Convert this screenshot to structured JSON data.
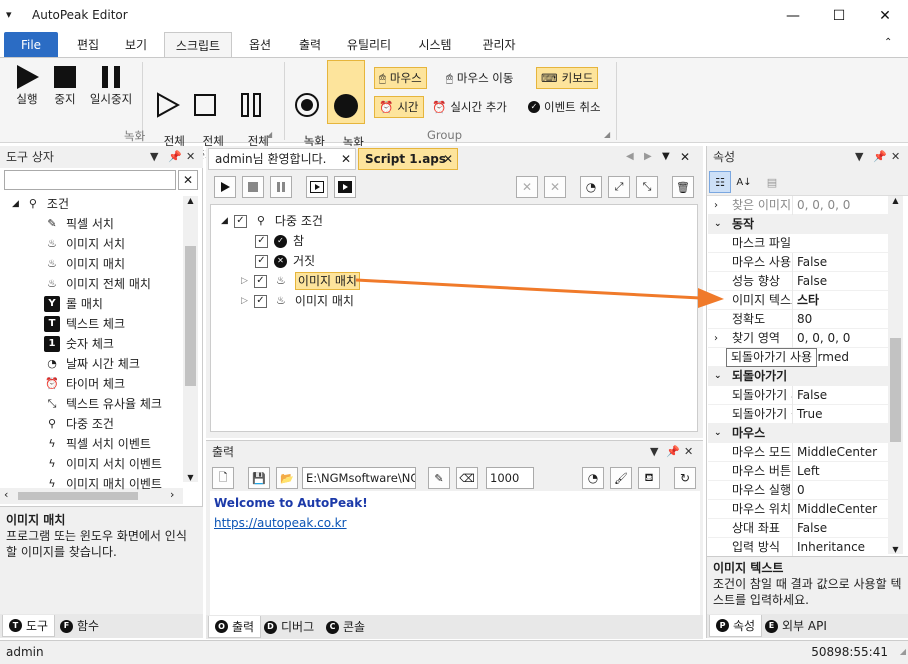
{
  "window": {
    "title": "AutoPeak Editor"
  },
  "menu": {
    "file": "File",
    "tabs": [
      "편집",
      "보기",
      "스크립트",
      "옵션",
      "출력",
      "유틸리티",
      "시스템",
      "관리자"
    ]
  },
  "ribbon": {
    "record_group": {
      "run": "실행",
      "stop": "중지",
      "pause": "일시중지",
      "run_all": "전체\n실행",
      "stop_all": "전체\n중지",
      "pause_all": "전체\n일시중지",
      "label": "녹화"
    },
    "group": {
      "record_start": "녹화\n시작",
      "record_stop": "녹화\n중지",
      "mouse": "마우스",
      "mouse_move": "마우스 이동",
      "keyboard": "키보드",
      "time": "시간",
      "add_realtime": "실시간 추가",
      "cancel_event": "이벤트 취소",
      "label": "Group"
    }
  },
  "toolbox": {
    "title": "도구 상자",
    "root": "조건",
    "items": [
      "픽셀 서치",
      "이미지 서치",
      "이미지 매치",
      "이미지 전체 매치",
      "롤 매치",
      "텍스트 체크",
      "숫자 체크",
      "날짜 시간 체크",
      "타이머 체크",
      "텍스트 유사율 체크",
      "다중 조건",
      "픽셀 서치 이벤트",
      "이미지 서치 이벤트",
      "이미지 매치 이벤트"
    ],
    "desc_title": "이미지 매치",
    "desc_text": "프로그램 또는 윈도우 화면에서 인식할 이미지를 찾습니다.",
    "tabs": [
      "도구",
      "함수"
    ],
    "tab_letters": [
      "T",
      "F"
    ]
  },
  "editor": {
    "tabs": [
      "admin님 환영합니다.",
      "Script 1.aps"
    ],
    "tree": {
      "root": "다중 조건",
      "children": [
        "참",
        "거짓",
        "이미지 매치",
        "이미지 매치"
      ]
    }
  },
  "output": {
    "title": "출력",
    "path": "E:\\NGMsoftware\\NG",
    "count": "1000",
    "welcome": "Welcome to AutoPeak!",
    "link": "https://autopeak.co.kr",
    "tabs": [
      "출력",
      "디버그",
      "콘솔"
    ],
    "tab_letters": [
      "O",
      "D",
      "C"
    ]
  },
  "properties": {
    "title": "속성",
    "top_row": {
      "name": "찾은 이미지",
      "value": "0, 0, 0, 0"
    },
    "cat_action": "동작",
    "action_rows": [
      {
        "name": "마스크 파일",
        "value": ""
      },
      {
        "name": "마우스 사용",
        "value": "False"
      },
      {
        "name": "성능 향상",
        "value": "False"
      },
      {
        "name": "이미지 텍스트",
        "value": "스타"
      },
      {
        "name": "정확도",
        "value": "80"
      },
      {
        "name": "찾기 영역",
        "value": "0, 0, 0, 0"
      },
      {
        "name": "",
        "value": "fNormed"
      }
    ],
    "tooltip": "되돌아가기 사용",
    "cat_return": "되돌아가기",
    "return_rows": [
      {
        "name": "되돌아가기 사용",
        "value": "False"
      },
      {
        "name": "되돌아가기 값",
        "value": "True"
      }
    ],
    "cat_mouse": "마우스",
    "mouse_rows": [
      {
        "name": "마우스 모드",
        "value": "MiddleCenter"
      },
      {
        "name": "마우스 버튼",
        "value": "Left"
      },
      {
        "name": "마우스 실행",
        "value": "0"
      },
      {
        "name": "마우스 위치",
        "value": "MiddleCenter"
      },
      {
        "name": "상대 좌표",
        "value": "False"
      },
      {
        "name": "입력 방식",
        "value": "Inheritance"
      }
    ],
    "desc_title": "이미지 텍스트",
    "desc_text": "조건이 참일 때 결과 값으로 사용할 텍스트를 입력하세요.",
    "tabs": [
      "속성",
      "외부 API"
    ],
    "tab_letters": [
      "P",
      "E"
    ]
  },
  "status": {
    "user": "admin",
    "clock": "50898:55:41"
  },
  "colors": {
    "accent": "#2b6cc4",
    "highlight": "#fde49c",
    "arrow": "#f07a2a",
    "link": "#0b54b5"
  }
}
